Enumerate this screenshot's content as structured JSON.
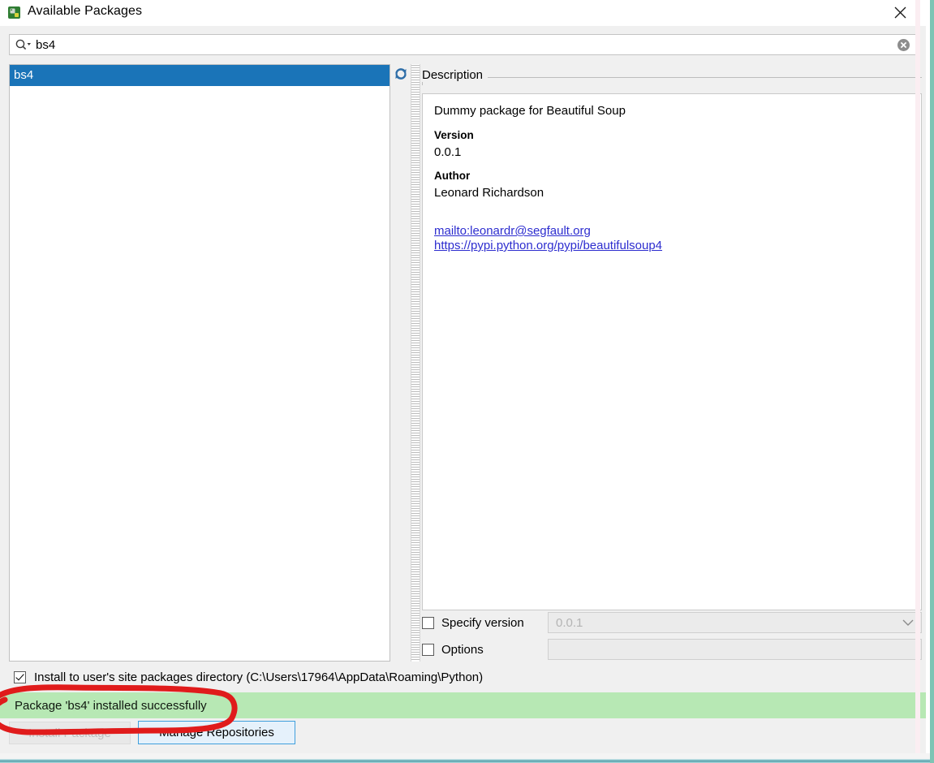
{
  "window": {
    "title": "Available Packages",
    "app_icon": "python-package-icon",
    "close_label": "Close"
  },
  "search": {
    "icon": "search-icon",
    "value": "bs4",
    "placeholder": "",
    "clear_icon": "clear-circle-icon"
  },
  "package_list": {
    "refresh_icon": "refresh-icon",
    "items": [
      {
        "name": "bs4",
        "selected": true
      }
    ]
  },
  "description": {
    "group_label": "Description",
    "summary": "Dummy package for Beautiful Soup",
    "fields": [
      {
        "key": "Version",
        "value": "0.0.1"
      },
      {
        "key": "Author",
        "value": "Leonard Richardson"
      }
    ],
    "links": [
      "mailto:leonardr@segfault.org",
      "https://pypi.python.org/pypi/beautifulsoup4"
    ]
  },
  "options": {
    "specify_version": {
      "label": "Specify version",
      "checked": false,
      "value": "0.0.1",
      "caret_icon": "chevron-down-icon"
    },
    "extra_options": {
      "label": "Options",
      "checked": false,
      "value": ""
    }
  },
  "user_site": {
    "label": "Install to user's site packages directory (C:\\Users\\17964\\AppData\\Roaming\\Python)",
    "checked": true
  },
  "status": {
    "message": "Package 'bs4' installed successfully",
    "background": "#b7e8b4"
  },
  "buttons": {
    "install": {
      "label": "Install Package",
      "enabled": false
    },
    "manage": {
      "label": "Manage Repositories",
      "enabled": true
    }
  },
  "annotation": {
    "type": "hand-drawn-ellipse",
    "color": "#e01b1b",
    "target": "status-message"
  },
  "colors": {
    "selection_blue": "#1a74b8",
    "success_green": "#b7e8b4",
    "link_blue": "#2d2dcf",
    "annotation_red": "#e01b1b"
  }
}
